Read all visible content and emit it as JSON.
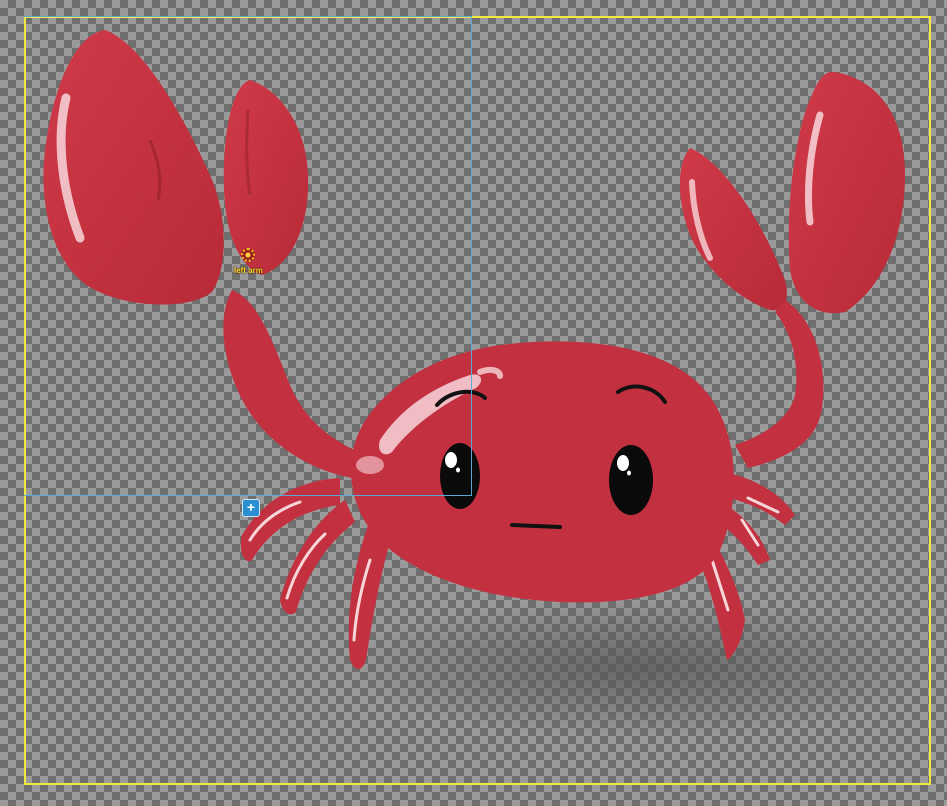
{
  "bone": {
    "label": "left arm",
    "icon": "pivot-target-icon"
  },
  "handle": {
    "symbol": "+",
    "icon": "plus-icon"
  },
  "colors": {
    "crab_red": "#c3303f",
    "crab_shadow": "#a8242f",
    "highlight": "#f7d6da",
    "eye": "#0a0a0a",
    "canvas_border": "#f2e840",
    "selection_border": "#59a8d8",
    "handle_blue": "#2a8fd0",
    "label_yellow": "#f5e02a"
  }
}
